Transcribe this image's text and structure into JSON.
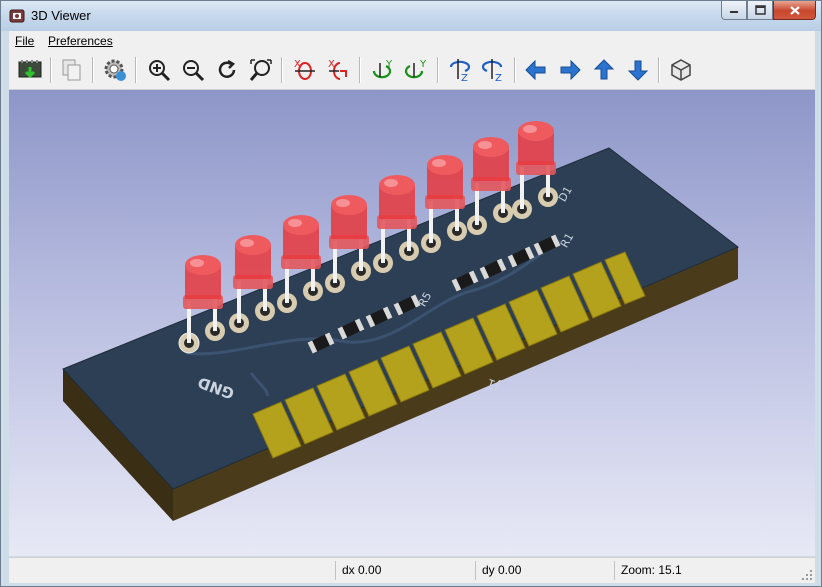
{
  "window": {
    "title": "3D Viewer"
  },
  "menu": {
    "file": "File",
    "preferences": "Preferences"
  },
  "toolbar": {
    "icons": [
      "reload-board-icon",
      "copy-image-icon",
      "render-options-icon",
      "zoom-in-icon",
      "zoom-out-icon",
      "redraw-icon",
      "zoom-auto-icon",
      "rotate-x-cw-icon",
      "rotate-x-ccw-icon",
      "rotate-y-cw-icon",
      "rotate-y-ccw-icon",
      "rotate-z-cw-icon",
      "rotate-z-ccw-icon",
      "pan-left-icon",
      "pan-right-icon",
      "pan-up-icon",
      "pan-down-icon",
      "orthographic-toggle-icon"
    ]
  },
  "board": {
    "silkscreen": [
      "GND",
      "J1",
      "D1",
      "R1",
      "R5"
    ]
  },
  "status": {
    "dx": "dx 0.00",
    "dy": "dy 0.00",
    "zoom": "Zoom: 15.1"
  },
  "colors": {
    "pcb": "#2c3e52",
    "gold": "#b5a21c",
    "led": "#e8383d"
  }
}
